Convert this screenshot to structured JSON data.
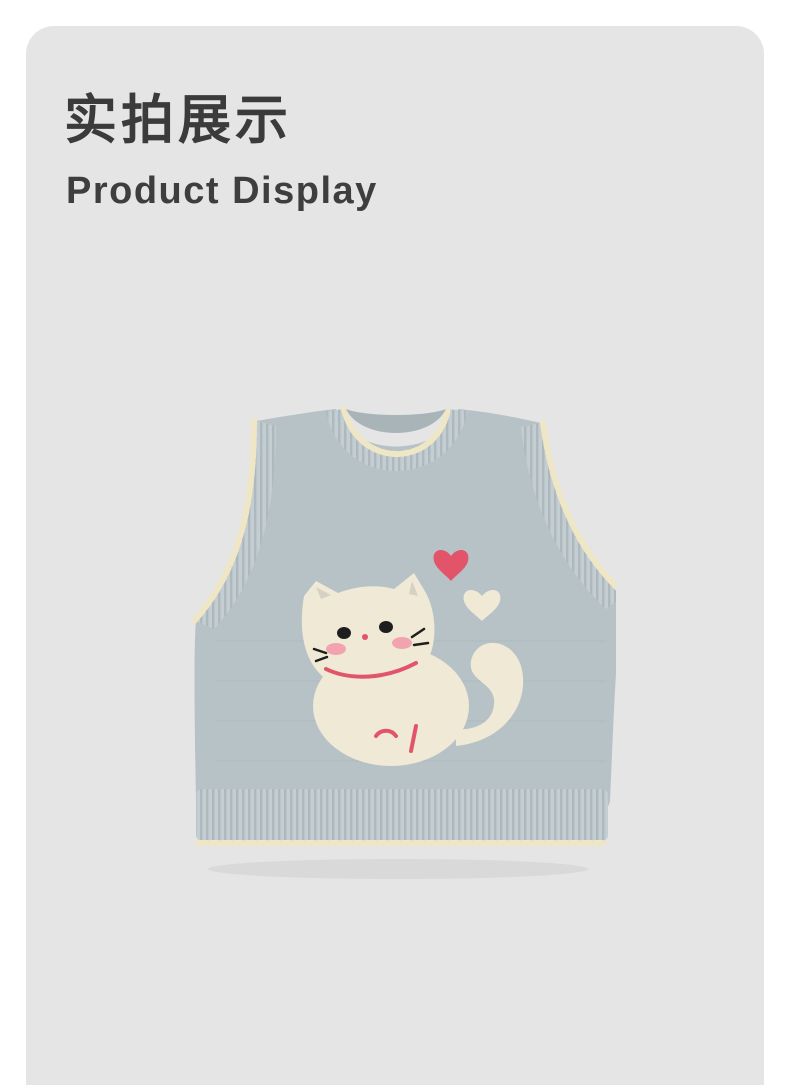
{
  "header": {
    "title_cn": "实拍展示",
    "title_en": "Product Display"
  },
  "product": {
    "image": "product-photo-icon",
    "colors": {
      "knit": "#b8c4c9",
      "rib": "#c4ced3",
      "trim": "#efe6c6",
      "cat": "#efe9d6",
      "accent_pink": "#e2546a"
    }
  },
  "theme": {
    "background": "#e5e5e5",
    "page": "#ffffff",
    "text": "#3b3b3b"
  }
}
